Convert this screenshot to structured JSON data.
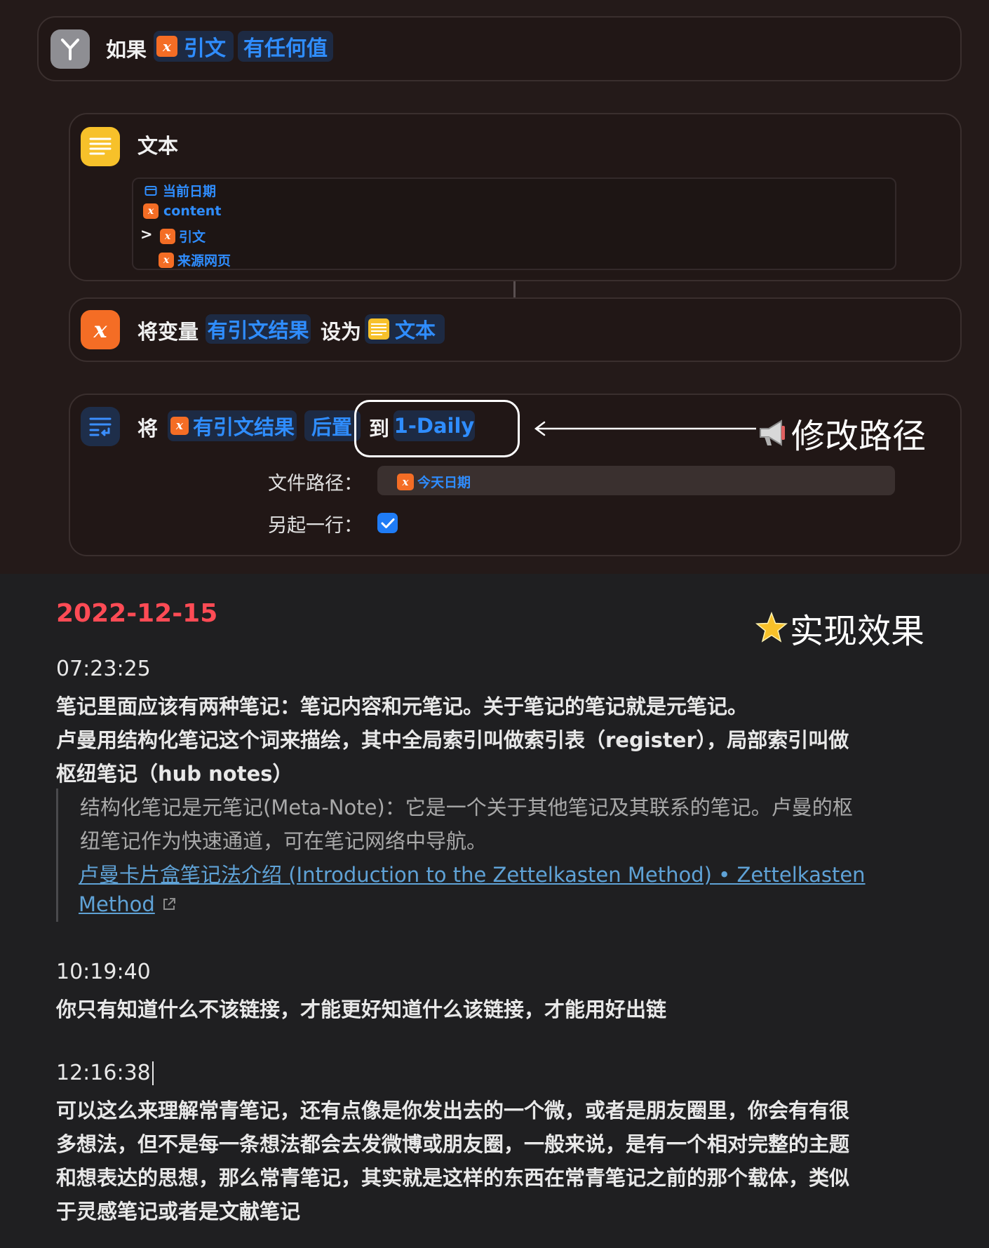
{
  "if_block": {
    "keyword": "如果",
    "variable": "引文",
    "condition": "有任何值"
  },
  "text_block": {
    "title": "文本",
    "lines": [
      "当前日期",
      "content",
      ">",
      "引文",
      "来源网页"
    ]
  },
  "set_var": {
    "prefix": "将变量",
    "var_name": "有引文结果",
    "mid": "设为",
    "value": "文本"
  },
  "append": {
    "prefix": "将",
    "var_name": "有引文结果",
    "op": "后置",
    "to": "到",
    "target": "1-Daily",
    "annotation": "修改路径",
    "path_label": "文件路径：",
    "path_value": "今天日期",
    "newline_label": "另起一行：",
    "newline_checked": true
  },
  "result": {
    "date": "2022-12-15",
    "annotation": "实现效果",
    "entries": [
      {
        "time": "07:23:25",
        "lines": [
          "笔记里面应该有两种笔记：笔记内容和元笔记。关于笔记的笔记就是元笔记。",
          "卢曼用结构化笔记这个词来描绘，其中全局索引叫做索引表（register），局部索引叫做",
          "枢纽笔记（hub notes）"
        ],
        "quote": [
          "结构化笔记是元笔记(Meta-Note)：它是一个关于其他笔记及其联系的笔记。卢曼的枢",
          "纽笔记作为快速通道，可在笔记网络中导航。"
        ],
        "link": [
          "卢曼卡片盒笔记法介绍 (Introduction to the Zettelkasten Method) • Zettelkasten",
          "Method"
        ]
      },
      {
        "time": "10:19:40",
        "lines": [
          "你只有知道什么不该链接，才能更好知道什么该链接，才能用好出链"
        ]
      },
      {
        "time": "12:16:38",
        "lines": [
          "可以这么来理解常青笔记，还有点像是你发出去的一个微，或者是朋友圈里，你会有有很",
          "多想法，但不是每一条想法都会去发微博或朋友圈，一般来说，是有一个相对完整的主题",
          "和想表达的思想，那么常青笔记，其实就是这样的东西在常青笔记之前的那个载体，类似",
          "于灵感笔记或者是文献笔记"
        ]
      }
    ]
  },
  "colors": {
    "accent_blue": "#2f8dff",
    "date_red": "#ff4b55",
    "var_orange": "#f46d25",
    "text_yellow": "#f7c12a"
  }
}
